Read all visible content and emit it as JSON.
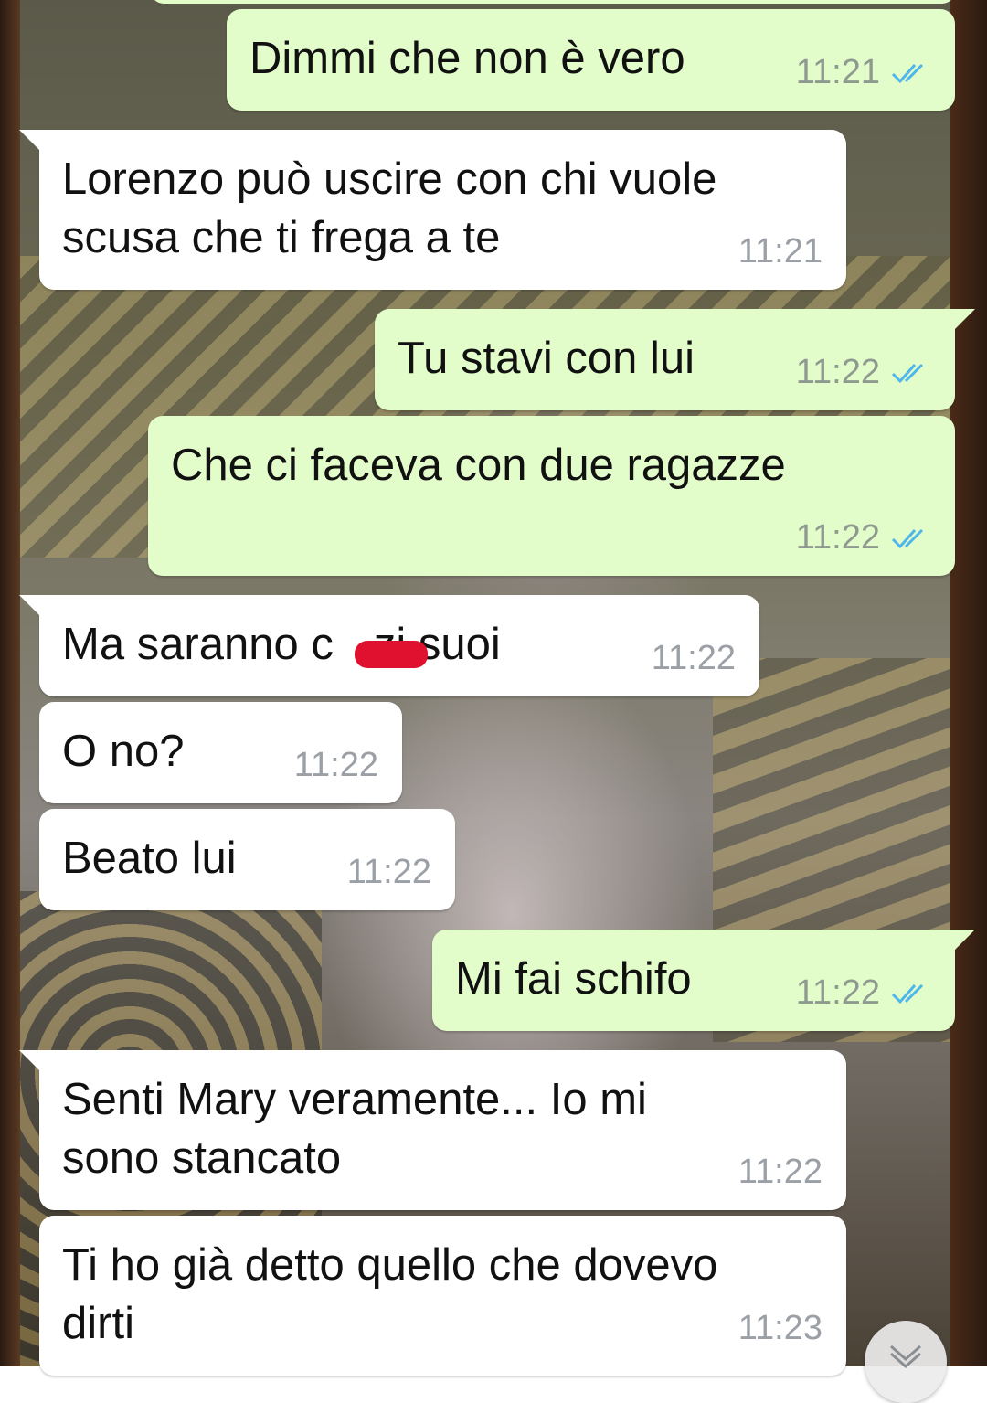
{
  "chat": {
    "messages": [
      {
        "direction": "out",
        "text": "Dimmi che non è vero",
        "time": "11:21",
        "read": true
      },
      {
        "direction": "in",
        "text": "Lorenzo può uscire con chi vuole\nscusa che ti frega a te",
        "time": "11:21"
      },
      {
        "direction": "out",
        "text": "Tu stavi con lui",
        "time": "11:22",
        "read": true
      },
      {
        "direction": "out",
        "text": "Che ci faceva con due ragazze",
        "time": "11:22",
        "read": true
      },
      {
        "direction": "in",
        "text_before": "Ma saranno c",
        "text_after": "zi suoi",
        "time": "11:22",
        "redacted": true
      },
      {
        "direction": "in",
        "text": "O no?",
        "time": "11:22"
      },
      {
        "direction": "in",
        "text": "Beato lui",
        "time": "11:22"
      },
      {
        "direction": "out",
        "text": "Mi fai schifo",
        "time": "11:22",
        "read": true
      },
      {
        "direction": "in",
        "text": "Senti Mary veramente... Io mi\nsono stancato",
        "time": "11:22"
      },
      {
        "direction": "in",
        "text": "Ti ho già detto quello che dovevo\ndirti",
        "time": "11:23"
      }
    ]
  },
  "icons": {
    "read_receipt": "double-check-icon",
    "scroll_down": "chevron-down-icon"
  },
  "colors": {
    "outgoing_bubble": "#e2fdca",
    "incoming_bubble": "#ffffff",
    "read_tick": "#4fb6ec",
    "timestamp": "#9aa0a6",
    "redaction": "#e0112f"
  }
}
